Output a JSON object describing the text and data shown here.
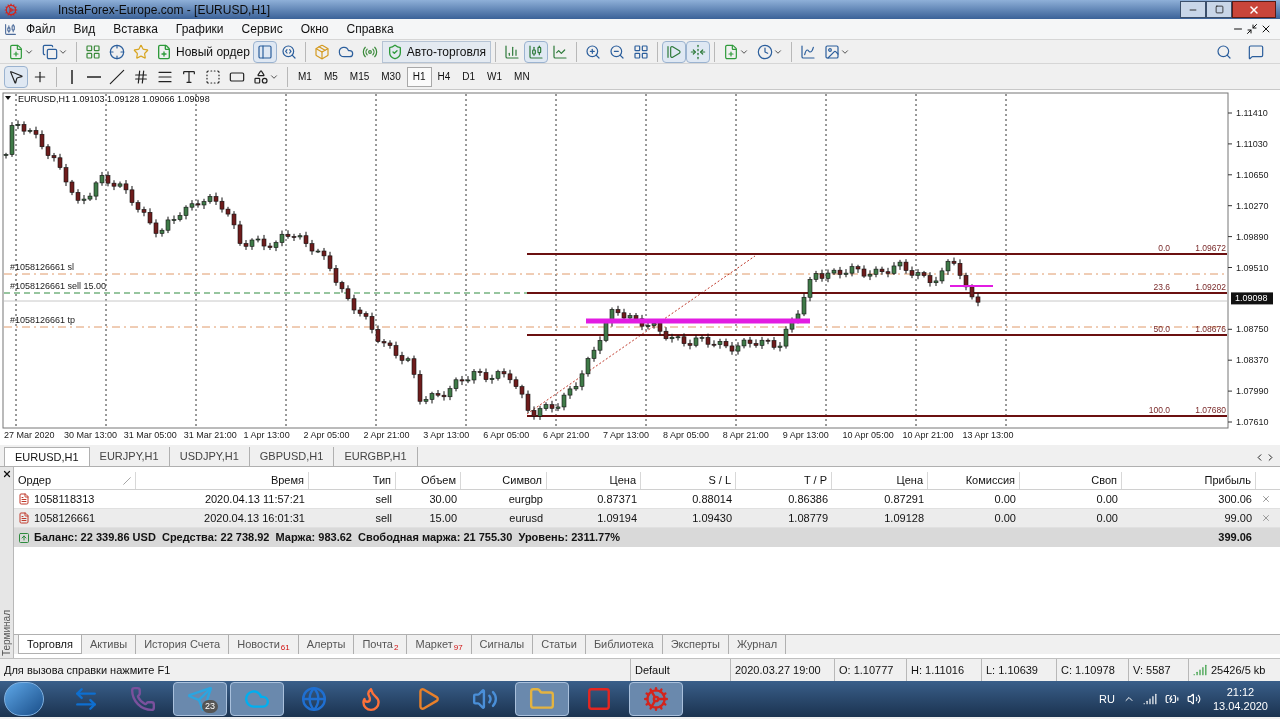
{
  "window": {
    "title": "InstaForex-Europe.com - [EURUSD,H1]"
  },
  "menu": [
    "Файл",
    "Вид",
    "Вставка",
    "Графики",
    "Сервис",
    "Окно",
    "Справка"
  ],
  "toolbar": {
    "new_order": "Новый ордер",
    "auto_trading": "Авто-торговля",
    "timeframes": [
      {
        "label": "M1",
        "selected": false
      },
      {
        "label": "M5",
        "selected": false
      },
      {
        "label": "M15",
        "selected": false
      },
      {
        "label": "M30",
        "selected": false
      },
      {
        "label": "H1",
        "selected": true
      },
      {
        "label": "H4",
        "selected": false
      },
      {
        "label": "D1",
        "selected": false
      },
      {
        "label": "W1",
        "selected": false
      },
      {
        "label": "MN",
        "selected": false
      }
    ]
  },
  "chart": {
    "symbol": "EURUSD,H1",
    "ohlc": "1.09103 1.09128 1.09066 1.09098",
    "price_axis": [
      {
        "label": "1.11410",
        "kind": "tick"
      },
      {
        "label": "1.11030",
        "kind": "tick"
      },
      {
        "label": "1.10650",
        "kind": "tick"
      },
      {
        "label": "1.10270",
        "kind": "tick"
      },
      {
        "label": "1.09890",
        "kind": "tick"
      },
      {
        "label": "1.09510",
        "kind": "tick"
      },
      {
        "label": "1.09098",
        "kind": "current"
      },
      {
        "label": "1.08750",
        "kind": "tick"
      },
      {
        "label": "1.08370",
        "kind": "tick"
      },
      {
        "label": "1.07990",
        "kind": "tick"
      },
      {
        "label": "1.07610",
        "kind": "tick"
      }
    ],
    "time_axis": [
      "27 Mar 2020",
      "30 Mar 13:00",
      "31 Mar 05:00",
      "31 Mar 21:00",
      "1 Apr 13:00",
      "2 Apr 05:00",
      "2 Apr 21:00",
      "3 Apr 13:00",
      "6 Apr 05:00",
      "6 Apr 21:00",
      "7 Apr 13:00",
      "8 Apr 05:00",
      "8 Apr 21:00",
      "9 Apr 13:00",
      "10 Apr 05:00",
      "10 Apr 21:00",
      "13 Apr 13:00"
    ],
    "order_lines": [
      {
        "label": "#1058126661 sl",
        "kind": "sl"
      },
      {
        "label": "#1058126661 sell 15.00",
        "kind": "open"
      },
      {
        "label": "#1058126661 tp",
        "kind": "tp"
      }
    ],
    "fibonacci": [
      {
        "level": "0.0",
        "price": "1.09672"
      },
      {
        "level": "23.6",
        "price": "1.09202"
      },
      {
        "level": "50.0",
        "price": "1.08676"
      },
      {
        "level": "100.0",
        "price": "1.07680"
      }
    ]
  },
  "chart_tabs": [
    {
      "label": "EURUSD,H1",
      "selected": true
    },
    {
      "label": "EURJPY,H1",
      "selected": false
    },
    {
      "label": "USDJPY,H1",
      "selected": false
    },
    {
      "label": "GBPUSD,H1",
      "selected": false
    },
    {
      "label": "EURGBP,H1",
      "selected": false
    }
  ],
  "terminal": {
    "side_label": "Терминал",
    "columns": [
      "Ордер",
      "Время",
      "Тип",
      "Объем",
      "Символ",
      "Цена",
      "S / L",
      "T / P",
      "Цена",
      "Комиссия",
      "Своп",
      "Прибыль"
    ],
    "rows": [
      [
        "1058118313",
        "2020.04.13 11:57:21",
        "sell",
        "30.00",
        "eurgbp",
        "0.87371",
        "0.88014",
        "0.86386",
        "0.87291",
        "0.00",
        "0.00",
        "300.06"
      ],
      [
        "1058126661",
        "2020.04.13 16:01:31",
        "sell",
        "15.00",
        "eurusd",
        "1.09194",
        "1.09430",
        "1.08779",
        "1.09128",
        "0.00",
        "0.00",
        "99.00"
      ]
    ],
    "summary": {
      "text": "Баланс: 22 339.86 USD  Средства: 22 738.92  Маржа: 983.62  Свободная маржа: 21 755.30  Уровень: 2311.77%",
      "profit": "399.06"
    },
    "tabs": [
      {
        "label": "Торговля",
        "selected": true
      },
      {
        "label": "Активы",
        "selected": false
      },
      {
        "label": "История Счета",
        "selected": false
      },
      {
        "label": "Новости",
        "badge": "61",
        "selected": false
      },
      {
        "label": "Алерты",
        "selected": false
      },
      {
        "label": "Почта",
        "badge": "2",
        "selected": false
      },
      {
        "label": "Маркет",
        "badge": "97",
        "selected": false
      },
      {
        "label": "Сигналы",
        "selected": false
      },
      {
        "label": "Статьи",
        "selected": false
      },
      {
        "label": "Библиотека",
        "selected": false
      },
      {
        "label": "Эксперты",
        "selected": false
      },
      {
        "label": "Журнал",
        "selected": false
      }
    ]
  },
  "status_bar": {
    "help": "Для вызова справки нажмите F1",
    "profile": "Default",
    "time": "2020.03.27 19:00",
    "open": "O: 1.10777",
    "high": "H: 1.11016",
    "low": "L: 1.10639",
    "close": "C: 1.10978",
    "volume": "V: 5587",
    "traffic": "25426/5 kb"
  },
  "taskbar": {
    "apps": [
      {
        "kind": "teamviewer",
        "running": false
      },
      {
        "kind": "viber",
        "running": false
      },
      {
        "kind": "telegram",
        "running": true,
        "badge": "23"
      },
      {
        "kind": "skype",
        "running": true
      },
      {
        "kind": "browser",
        "running": false
      },
      {
        "kind": "firefox",
        "running": false
      },
      {
        "kind": "player",
        "running": false
      },
      {
        "kind": "audio",
        "running": false
      },
      {
        "kind": "files",
        "running": true
      },
      {
        "kind": "yandex",
        "running": false
      },
      {
        "kind": "terminal",
        "running": true
      }
    ],
    "language": "RU",
    "clock": "21:12",
    "date": "13.04.2020"
  }
}
